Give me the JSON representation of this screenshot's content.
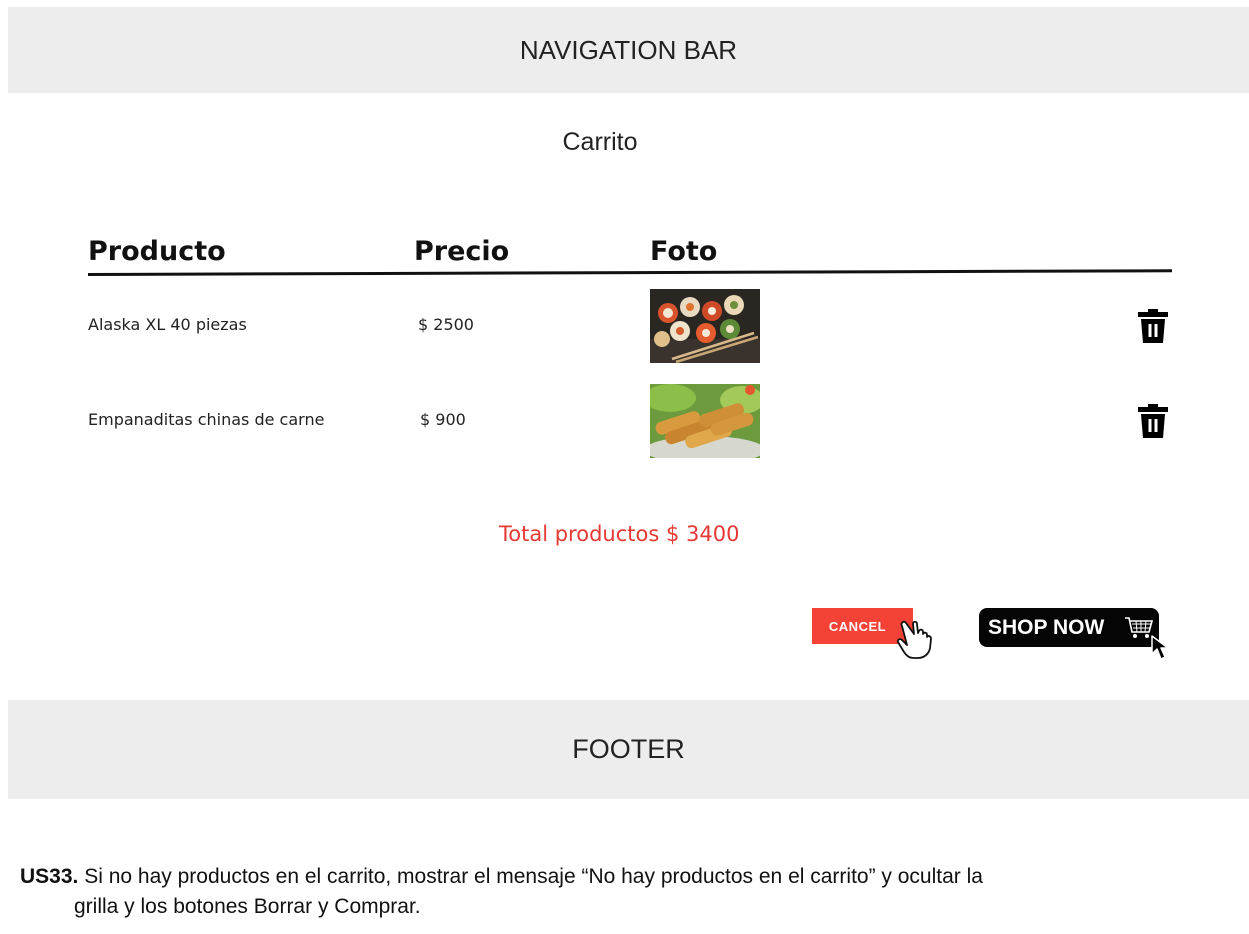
{
  "navbar": {
    "label": "NAVIGATION BAR"
  },
  "page": {
    "title": "Carrito"
  },
  "table": {
    "headers": [
      "Producto",
      "Precio",
      "Foto"
    ],
    "rows": [
      {
        "product": "Alaska XL 40 piezas",
        "price": "$ 2500",
        "photo_icon": "sushi-photo",
        "delete_icon": "trash-icon"
      },
      {
        "product": "Empanaditas chinas de carne",
        "price": "$ 900",
        "photo_icon": "spring-rolls-photo",
        "delete_icon": "trash-icon"
      }
    ]
  },
  "total": {
    "label": "Total productos $ 3400"
  },
  "buttons": {
    "cancel": "CANCEL",
    "shop_now": "SHOP NOW"
  },
  "footer": {
    "label": "FOOTER"
  },
  "story": {
    "id": "US33.",
    "line1": "Si no hay productos en el carrito, mostrar el mensaje “No hay productos en el carrito” y ocultar la",
    "line2": "grilla y los botones Borrar y Comprar."
  },
  "colors": {
    "accent_red": "#e53935",
    "cancel_bg": "#f44336",
    "shop_bg": "#050505",
    "bar_bg": "#ededed"
  }
}
